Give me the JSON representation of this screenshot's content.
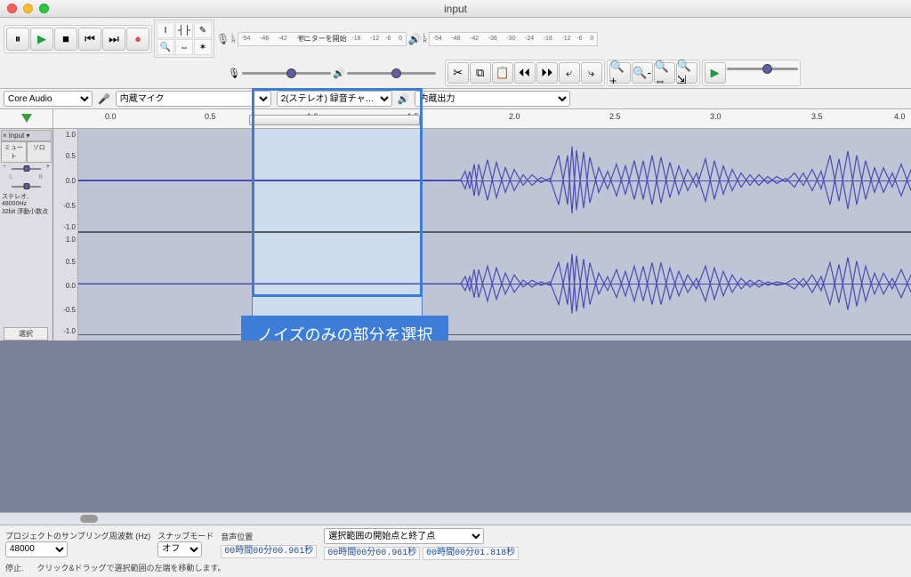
{
  "window": {
    "title": "input"
  },
  "transport": {
    "pause": "⏸",
    "play": "▶",
    "stop": "■",
    "skip_start": "⏮",
    "skip_end": "⏭",
    "record": "●"
  },
  "tools_grid": [
    "I",
    "┤├",
    "✎",
    "🔍",
    "⇔",
    "✶"
  ],
  "meters": {
    "rec_label": "L\nR",
    "rec_text": "モニターを開始",
    "play_label": "L\nR",
    "ticks": [
      "-54",
      "-48",
      "-42",
      "-36",
      "-30",
      "-24",
      "-18",
      "-12",
      "-6",
      "0"
    ]
  },
  "edit_tools": [
    "✂",
    "⧉",
    "📋",
    "⏴⏴",
    "⏵⏵",
    "⤶",
    "⤷"
  ],
  "zoom_tools": [
    "🔍+",
    "🔍-",
    "🔍⇔",
    "🔍⇲"
  ],
  "play_at_speed": "▶",
  "device": {
    "host_label": "Core Audio",
    "mic_icon": "🎤",
    "input_device": "内蔵マイク",
    "channels": "2(ステレオ) 録音チャ…",
    "speaker_icon": "🔊",
    "output_device": "内蔵出力"
  },
  "ruler": {
    "marks": [
      "0.0",
      "0.5",
      "1.0",
      "1.5",
      "2.0",
      "2.5",
      "3.0",
      "3.5",
      "4.0"
    ]
  },
  "track": {
    "name": "input",
    "mute": "ミュート",
    "solo": "ソロ",
    "l": "L",
    "r": "R",
    "format_line1": "ステレオ, 48000Hz",
    "format_line2": "32bit 浮動小数点",
    "select_btn": "選択"
  },
  "db_scale": [
    "1.0",
    "0.5",
    "0.0",
    "-0.5",
    "-1.0"
  ],
  "annotation": {
    "label": "ノイズのみの部分を選択"
  },
  "status": {
    "project_rate_label": "プロジェクトのサンプリング周波数 (Hz)",
    "project_rate": "48000",
    "snap_label": "スナップモード",
    "snap_value": "オフ",
    "audio_pos_label": "音声位置",
    "sel_label": "選択範囲の開始点と終了点",
    "time1": "00時間00分00.961秒",
    "time2": "00時間00分00.961秒",
    "time3": "00時間00分01.818秒",
    "bottom_left": "停止.",
    "bottom_right": "クリック&ドラッグで選択範囲の左端を移動します。"
  }
}
